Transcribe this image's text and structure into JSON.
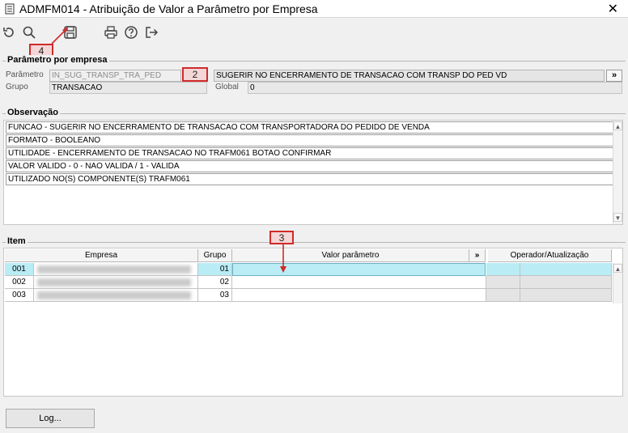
{
  "window": {
    "title": "ADMFM014 - Atribuição de Valor a Parâmetro por Empresa",
    "close_glyph": "✕"
  },
  "toolbar": {
    "buttons": [
      {
        "name": "refresh-icon"
      },
      {
        "name": "search-icon"
      },
      {
        "name": "save-icon"
      },
      {
        "name": "print-icon"
      },
      {
        "name": "help-icon"
      },
      {
        "name": "exit-icon"
      }
    ]
  },
  "annotations": {
    "marker_2": "2",
    "marker_3": "3",
    "marker_4": "4",
    "color": "#d12a2a"
  },
  "param_group": {
    "title": "Parâmetro por empresa",
    "param_label": "Parâmetro",
    "param_value": "IN_SUG_TRANSP_TRA_PED",
    "param_desc": "SUGERIR NO ENCERRAMENTO DE TRANSACAO COM TRANSP DO PED VD",
    "more_button": "»",
    "group_label": "Grupo",
    "group_value": "TRANSACAO",
    "global_label": "Global",
    "global_value": "0"
  },
  "obs_group": {
    "title": "Observação",
    "lines": [
      "FUNCAO - SUGERIR NO ENCERRAMENTO DE TRANSACAO COM TRANSPORTADORA DO PEDIDO DE VENDA",
      "FORMATO - BOOLEANO",
      "UTILIDADE - ENCERRAMENTO DE TRANSACAO NO TRAFM061 BOTAO CONFIRMAR",
      "VALOR VALIDO - 0 - NAO VALIDA / 1 - VALIDA",
      "UTILIZADO NO(S) COMPONENTE(S) TRAFM061"
    ]
  },
  "item_group": {
    "title": "Item",
    "headers": {
      "empresa": "Empresa",
      "grupo": "Grupo",
      "valor": "Valor parâmetro",
      "more": "»",
      "operador": "Operador/Atualização"
    },
    "rows": [
      {
        "code": "001",
        "grupo": "01",
        "valor": ""
      },
      {
        "code": "002",
        "grupo": "02",
        "valor": ""
      },
      {
        "code": "003",
        "grupo": "03",
        "valor": ""
      }
    ],
    "selected_row_color": "#b9ecf5"
  },
  "footer": {
    "log_button": "Log..."
  }
}
